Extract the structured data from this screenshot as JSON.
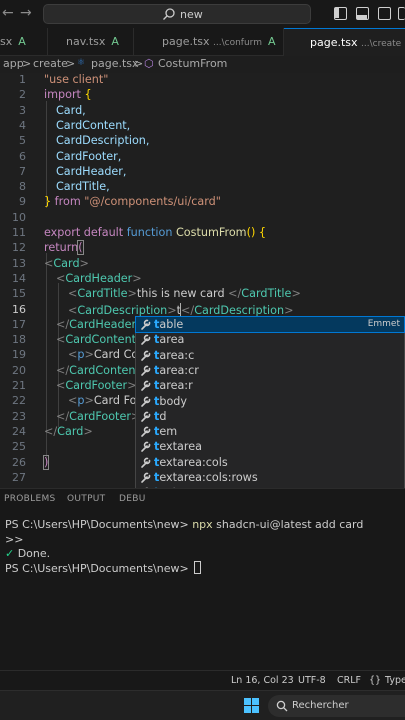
{
  "titlebar": {
    "search_text": "new"
  },
  "tabs": [
    {
      "name": "sx",
      "modified": "A",
      "path": "",
      "active": false
    },
    {
      "name": "nav.tsx",
      "modified": "A",
      "path": "",
      "active": false
    },
    {
      "name": "page.tsx",
      "modified": "A",
      "path": "...\\confurm",
      "active": false
    },
    {
      "name": "page.tsx",
      "modified": "",
      "path": "...\\create",
      "active": true,
      "close": "×"
    }
  ],
  "breadcrumbs": [
    "app",
    ">",
    "create",
    ">",
    "page.tsx",
    ">",
    "CostumFrom"
  ],
  "editor": {
    "current_line": 16,
    "line_numbers": [
      "1",
      "2",
      "3",
      "4",
      "5",
      "6",
      "7",
      "8",
      "9",
      "10",
      "11",
      "12",
      "13",
      "14",
      "15",
      "16",
      "17",
      "18",
      "19",
      "20",
      "21",
      "22",
      "23",
      "24",
      "25",
      "26",
      "27"
    ],
    "code": {
      "l1": "\"use client\"",
      "l2_kw": "import",
      "l2_rest": " {",
      "l3": "Card,",
      "l4": "CardContent,",
      "l5": "CardDescription,",
      "l6": "CardFooter,",
      "l7": "CardHeader,",
      "l8": "CardTitle,",
      "l9_brace": "}",
      "l9_from": " from ",
      "l9_str": "\"@/components/ui/card\"",
      "l11_export": "export",
      "l11_default": " default",
      "l11_function": " function ",
      "l11_name": "CostumFrom",
      "l11_rest": "() {",
      "l12_kw": "return",
      "l12_paren": "(",
      "l13_tag": "Card",
      "l14_tag": "CardHeader",
      "l15_tag": "CardTitle",
      "l15_text": "this is new card ",
      "l15_close": "CardTitle",
      "l16_tag": "CardDescription",
      "l16_typed": "t",
      "l16_close": "CardDescription",
      "l17_tag": "CardHeader",
      "l18_tag": "CardContent",
      "l19_tag": "p",
      "l19_text": "Card Con",
      "l20_tag": "CardContent",
      "l21_tag": "CardFooter",
      "l22_tag": "p",
      "l22_text": "Card Foo",
      "l23_tag": "CardFooter",
      "l24_tag": "Card",
      "l26": ")"
    }
  },
  "suggestions": {
    "items": [
      {
        "first": "t",
        "rest": "able",
        "detail": "Emmet"
      },
      {
        "first": "t",
        "rest": "area"
      },
      {
        "first": "t",
        "rest": "area:c"
      },
      {
        "first": "t",
        "rest": "area:cr"
      },
      {
        "first": "t",
        "rest": "area:r"
      },
      {
        "first": "t",
        "rest": "body"
      },
      {
        "first": "t",
        "rest": "d"
      },
      {
        "first": "t",
        "rest": "em"
      },
      {
        "first": "t",
        "rest": "extarea"
      },
      {
        "first": "t",
        "rest": "extarea:cols"
      },
      {
        "first": "t",
        "rest": "extarea:cols:rows"
      },
      {
        "first": "t",
        "rest": "extarea:rows"
      }
    ]
  },
  "panel": {
    "tabs": [
      "PROBLEMS",
      "OUTPUT",
      "DEBU"
    ],
    "terminal": {
      "prompt1": "PS C:\\Users\\HP\\Documents\\new> ",
      "cmd_name": "npx",
      "cmd_args": " shadcn-ui@latest add card",
      "line2": ">>",
      "check": "✓",
      "done": " Done.",
      "prompt2": "PS C:\\Users\\HP\\Documents\\new> "
    }
  },
  "statusbar": {
    "position": "Ln 16, Col 23",
    "encoding": "UTF-8",
    "eol": "CRLF",
    "braces": "{}",
    "language": "Type"
  },
  "taskbar": {
    "search_label": "Rechercher"
  },
  "colors": {
    "accent": "#0078d4",
    "keyword": "#c586c0",
    "component": "#4ec9b0",
    "string": "#ce9178"
  }
}
